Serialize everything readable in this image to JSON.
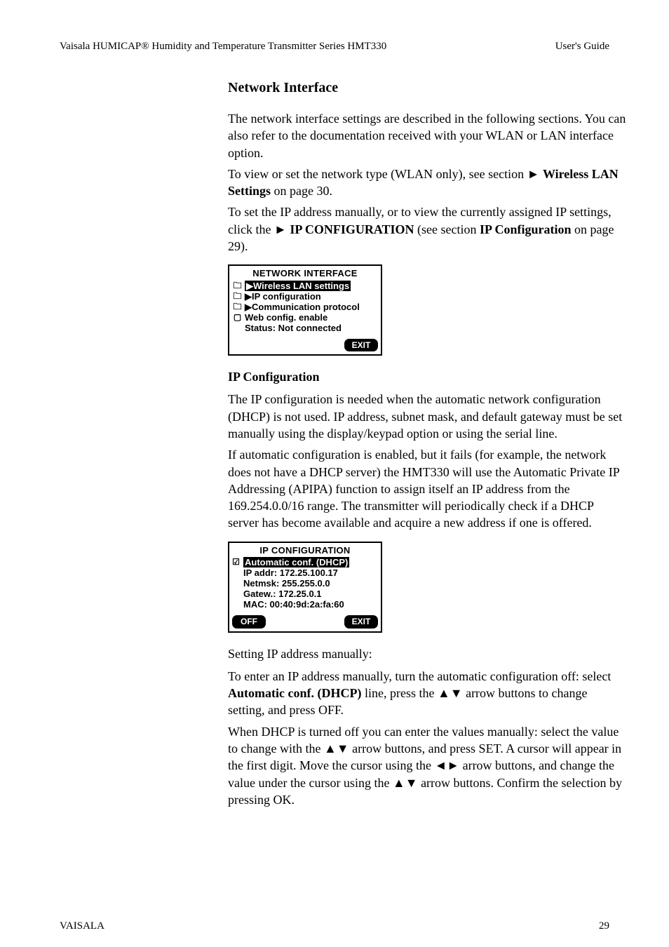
{
  "header": {
    "left": "Vaisala HUMICAP® Humidity and Temperature Transmitter Series HMT330",
    "right": "User's Guide"
  },
  "section": {
    "heading": "Network Interface",
    "intro1": "The network interface settings are described in the following sections. You can also refer to the documentation received with your WLAN or LAN interface option.",
    "intro2_a": "To view or set the network type (WLAN only), see section ",
    "intro2_link": "Wireless LAN Settings",
    "intro2_b": " on page 30.",
    "intro3_a": "To set the IP address manually, or to view the currently assigned IP settings, click the ",
    "intro3_bold": "IP CONFIGURATION",
    "intro3_b": " (see section ",
    "intro3_link": "IP Configuration",
    "intro3_c": " on page 29)."
  },
  "lcd1": {
    "title": "NETWORK INTERFACE",
    "row1": "Wireless LAN settings",
    "row2": "IP configuration",
    "row3": "Communication protocol",
    "row4": "Web config. enable",
    "row5": "Status: Not connected",
    "btn_exit": "EXIT"
  },
  "ipconf": {
    "heading": "IP Configuration",
    "p1": "The IP configuration is needed when the automatic network configuration (DHCP) is not used. IP address, subnet mask, and default gateway must be set manually using the display/keypad option or using the serial line.",
    "p2": "If automatic configuration is enabled, but it fails (for example, the network does not have a DHCP server) the HMT330 will use the Automatic Private IP Addressing (APIPA) function to assign itself an IP address from the 169.254.0.0/16 range. The transmitter will periodically check if a DHCP server has become available and acquire a new address if one is offered."
  },
  "lcd2": {
    "title": "IP CONFIGURATION",
    "row1": "Automatic conf. (DHCP)",
    "row2": "IP addr: 172.25.100.17",
    "row3": "Netmsk: 255.255.0.0",
    "row4": "Gatew.: 172.25.0.1",
    "row5": "MAC: 00:40:9d:2a:fa:60",
    "btn_off": "OFF",
    "btn_exit": "EXIT"
  },
  "setting": {
    "heading": "Setting IP address manually:",
    "step1_a": "To enter an IP address manually, turn the automatic configuration off: select ",
    "step1_bold": "Automatic conf. (DHCP)",
    "step1_b": " line, press the ▲▼ arrow buttons to change setting, and press OFF.",
    "step2": "When DHCP is turned off you can enter the values manually: select the value to change with the ▲▼ arrow buttons, and press SET. A cursor will appear in the first digit. Move the cursor using the ◄► arrow buttons, and change the value under the cursor using the ▲▼ arrow buttons. Confirm the selection by pressing OK."
  },
  "footer": {
    "left": "VAISALA",
    "page": "29"
  }
}
